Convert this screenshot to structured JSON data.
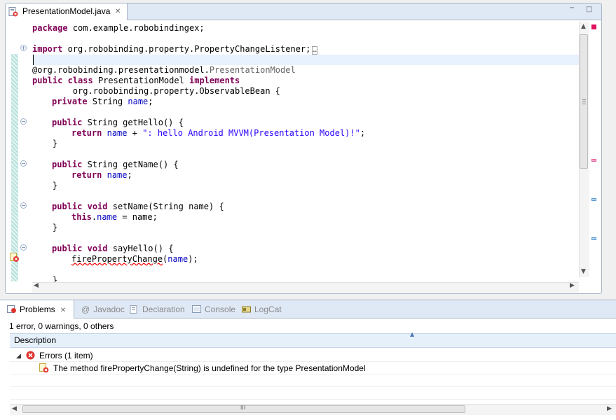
{
  "editor": {
    "tab_title": "PresentationModel.java",
    "close_glyph": "✕",
    "minimize_glyph": "−",
    "maximize_glyph": "□",
    "folded_marker": "…",
    "code": {
      "l1_kw": "package",
      "l1_rest": " com.example.robobindingex;",
      "l2_kw": "import",
      "l2_rest": " org.robobinding.property.PropertyChangeListener;",
      "l3_prefix": "@org.robobinding.presentationmodel.",
      "l3_ann": "PresentationModel",
      "l4_kw1": "public",
      "l4_kw2": "class",
      "l4_name": " PresentationModel ",
      "l4_kw3": "implements",
      "l5": "        org.robobinding.property.ObservableBean {",
      "l6_kw": "private",
      "l6_type": " String ",
      "l6_field": "name",
      "l6_end": ";",
      "l7_kw": "public",
      "l7_rest": " String getHello() {",
      "l8_kw": "return",
      "l8_field": "name",
      "l8_op": " + ",
      "l8_str": "\": hello Android MVVM(Presentation Model)!\"",
      "l8_end": ";",
      "l9": "    }",
      "l10_kw": "public",
      "l10_rest": " String getName() {",
      "l11_kw": "return",
      "l11_field": "name",
      "l11_end": ";",
      "l12": "    }",
      "l13_kw1": "public",
      "l13_kw2": "void",
      "l13_rest": " setName(String name) {",
      "l14_kw": "this",
      "l14_dot": ".",
      "l14_field": "name",
      "l14_rest": " = name;",
      "l15": "    }",
      "l16_kw1": "public",
      "l16_kw2": "void",
      "l16_rest": " sayHello() {",
      "l17_err": "firePropertyChange",
      "l17_open": "(",
      "l17_field": "name",
      "l17_end": ");",
      "l18": "    }"
    }
  },
  "views": {
    "tabs": [
      "Problems",
      "Javadoc",
      "Declaration",
      "Console",
      "LogCat"
    ],
    "javadoc_glyph": "@",
    "summary": "1 error, 0 warnings, 0 others",
    "column_description": "Description",
    "group_label": "Errors (1 item)",
    "problem_message": "The method firePropertyChange(String) is undefined for the type PresentationModel",
    "scroll_grip": "III"
  },
  "colors": {
    "keyword": "#7f0055",
    "field": "#0000c0",
    "string": "#2a00ff",
    "error": "#e0332e",
    "tab_bg": "#dfe8f5"
  }
}
